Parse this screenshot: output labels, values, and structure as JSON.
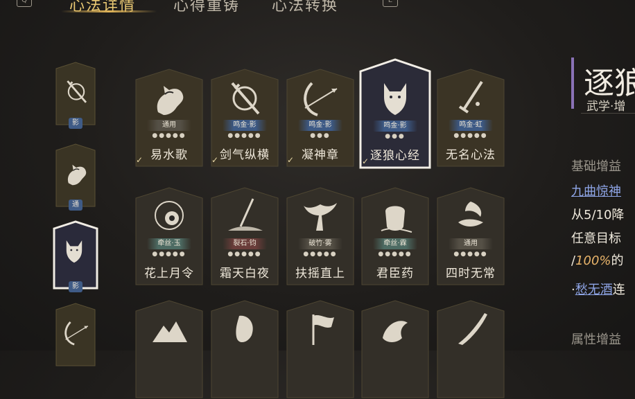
{
  "tabs": {
    "tab1": "心法详情",
    "tab2": "心得重铸",
    "tab3": "心法转换",
    "key_left": "Q",
    "key_right": "E"
  },
  "sidebar": [
    {
      "label": "影",
      "icon": "sword-wheel-icon"
    },
    {
      "label": "通",
      "icon": "horse-icon"
    },
    {
      "label": "影",
      "icon": "wolf-icon",
      "selected": true
    },
    {
      "label": "",
      "icon": "bow-icon"
    }
  ],
  "cards": [
    {
      "name": "易水歌",
      "tag": "通用",
      "tag_style": "plain",
      "icon": "horse-icon",
      "owned": true
    },
    {
      "name": "剑气纵横",
      "tag": "鸣金·影",
      "tag_style": "blue",
      "icon": "sword-wheel-icon",
      "owned": true
    },
    {
      "name": "凝神章",
      "tag": "鸣金·影",
      "tag_style": "blue",
      "icon": "bow-icon",
      "owned": true
    },
    {
      "name": "逐狼心经",
      "tag": "鸣金·影",
      "tag_style": "blue",
      "icon": "wolf-icon",
      "owned": true,
      "selected": true
    },
    {
      "name": "无名心法",
      "tag": "鸣金·虹",
      "tag_style": "blue",
      "icon": "sword-icon",
      "owned": false
    },
    {
      "name": "花上月令",
      "tag": "牵丝·玉",
      "tag_style": "green",
      "icon": "flower-moon-icon",
      "owned": false
    },
    {
      "name": "霜天白夜",
      "tag": "裂石·钧",
      "tag_style": "red",
      "icon": "spear-icon",
      "owned": false
    },
    {
      "name": "扶摇直上",
      "tag": "破竹·雾",
      "tag_style": "plain",
      "icon": "bird-icon",
      "owned": false
    },
    {
      "name": "君臣药",
      "tag": "牵丝·霖",
      "tag_style": "green",
      "icon": "pot-icon",
      "owned": false
    },
    {
      "name": "四时无常",
      "tag": "通用",
      "tag_style": "plain",
      "icon": "bird-moon-icon",
      "owned": false
    },
    {
      "name": "",
      "tag": "",
      "tag_style": "plain",
      "icon": "mountain-icon",
      "owned": false
    },
    {
      "name": "",
      "tag": "",
      "tag_style": "plain",
      "icon": "face-icon",
      "owned": false
    },
    {
      "name": "",
      "tag": "",
      "tag_style": "plain",
      "icon": "flag-icon",
      "owned": false
    },
    {
      "name": "",
      "tag": "",
      "tag_style": "plain",
      "icon": "dragon-icon",
      "owned": false
    },
    {
      "name": "",
      "tag": "",
      "tag_style": "plain",
      "icon": "blade-icon",
      "owned": false
    }
  ],
  "detail": {
    "title": "逐狼",
    "subtitle": "武学·增",
    "section1": "基础增益",
    "link1": "九曲惊神",
    "line_a": "从5/10降",
    "line_b": "任意目标",
    "line_c_pre": "/",
    "line_c_pct": "100%",
    "line_c_post": "的",
    "line_d_pre": "·",
    "line_d_link": "愁无酒",
    "line_d_post": "连",
    "section2": "属性增益"
  }
}
